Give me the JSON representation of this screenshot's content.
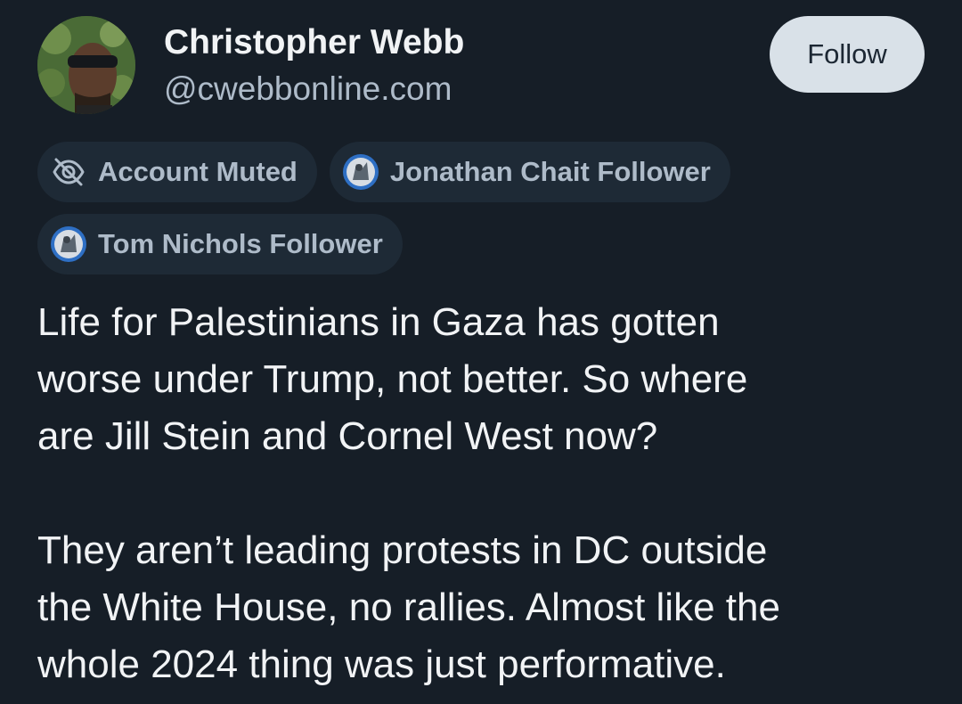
{
  "author": {
    "display_name": "Christopher Webb",
    "handle": "@cwebbonline.com",
    "avatar_icon": "user-avatar-photo"
  },
  "follow_button": {
    "label": "Follow"
  },
  "labels": [
    {
      "icon": "eye-slash-icon",
      "text": "Account Muted"
    },
    {
      "icon": "labeler-avatar-icon",
      "text": "Jonathan Chait Follower"
    },
    {
      "icon": "labeler-avatar-icon",
      "text": "Tom Nichols Follower"
    }
  ],
  "post": {
    "paragraphs": [
      "Life for Palestinians in Gaza has gotten\nworse under Trump, not better. So where\nare Jill Stein and Cornel West now?",
      "They aren’t leading protests in DC outside\nthe White House, no rallies. Almost like the\nwhole 2024 thing was just performative."
    ]
  },
  "colors": {
    "background": "#161e27",
    "text_primary": "#f1f3f5",
    "text_secondary": "#aebbc9",
    "pill_background": "#1e2a36",
    "button_background": "#d9e1e8"
  }
}
